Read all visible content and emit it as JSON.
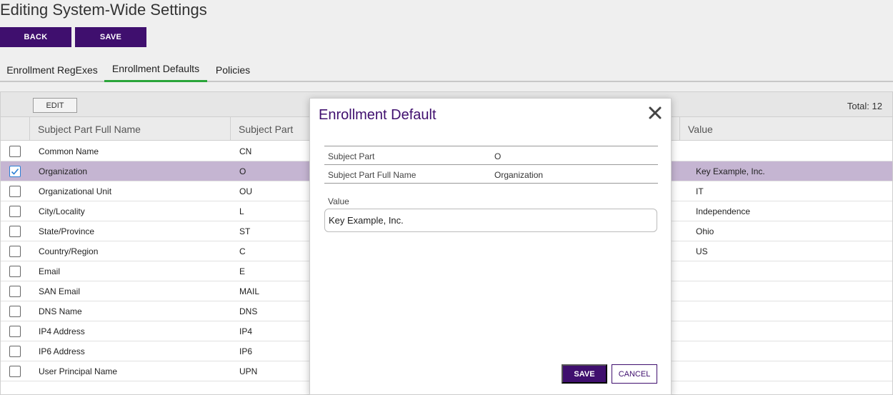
{
  "page": {
    "title": "Editing System-Wide Settings"
  },
  "actions": {
    "back": "BACK",
    "save": "SAVE"
  },
  "tabs": [
    {
      "label": "Enrollment RegExes",
      "active": false
    },
    {
      "label": "Enrollment Defaults",
      "active": true
    },
    {
      "label": "Policies",
      "active": false
    }
  ],
  "grid": {
    "edit_label": "EDIT",
    "total_label": "Total: 12",
    "columns": {
      "full_name": "Subject Part Full Name",
      "part": "Subject Part",
      "value": "Value"
    },
    "rows": [
      {
        "full_name": "Common Name",
        "part": "CN",
        "value": "",
        "checked": false
      },
      {
        "full_name": "Organization",
        "part": "O",
        "value": "Key Example, Inc.",
        "checked": true
      },
      {
        "full_name": "Organizational Unit",
        "part": "OU",
        "value": "IT",
        "checked": false
      },
      {
        "full_name": "City/Locality",
        "part": "L",
        "value": "Independence",
        "checked": false
      },
      {
        "full_name": "State/Province",
        "part": "ST",
        "value": "Ohio",
        "checked": false
      },
      {
        "full_name": "Country/Region",
        "part": "C",
        "value": "US",
        "checked": false
      },
      {
        "full_name": "Email",
        "part": "E",
        "value": "",
        "checked": false
      },
      {
        "full_name": "SAN Email",
        "part": "MAIL",
        "value": "",
        "checked": false
      },
      {
        "full_name": "DNS Name",
        "part": "DNS",
        "value": "",
        "checked": false
      },
      {
        "full_name": "IP4 Address",
        "part": "IP4",
        "value": "",
        "checked": false
      },
      {
        "full_name": "IP6 Address",
        "part": "IP6",
        "value": "",
        "checked": false
      },
      {
        "full_name": "User Principal Name",
        "part": "UPN",
        "value": "",
        "checked": false
      }
    ]
  },
  "modal": {
    "title": "Enrollment Default",
    "fields": [
      {
        "label": "Subject Part",
        "value": "O"
      },
      {
        "label": "Subject Part Full Name",
        "value": "Organization"
      }
    ],
    "value_label": "Value",
    "value_input": "Key Example, Inc.",
    "save": "SAVE",
    "cancel": "CANCEL"
  },
  "colors": {
    "brand": "#3f0f6e",
    "tab_active": "#2aa53a",
    "selected_row": "#c5b5d2"
  }
}
